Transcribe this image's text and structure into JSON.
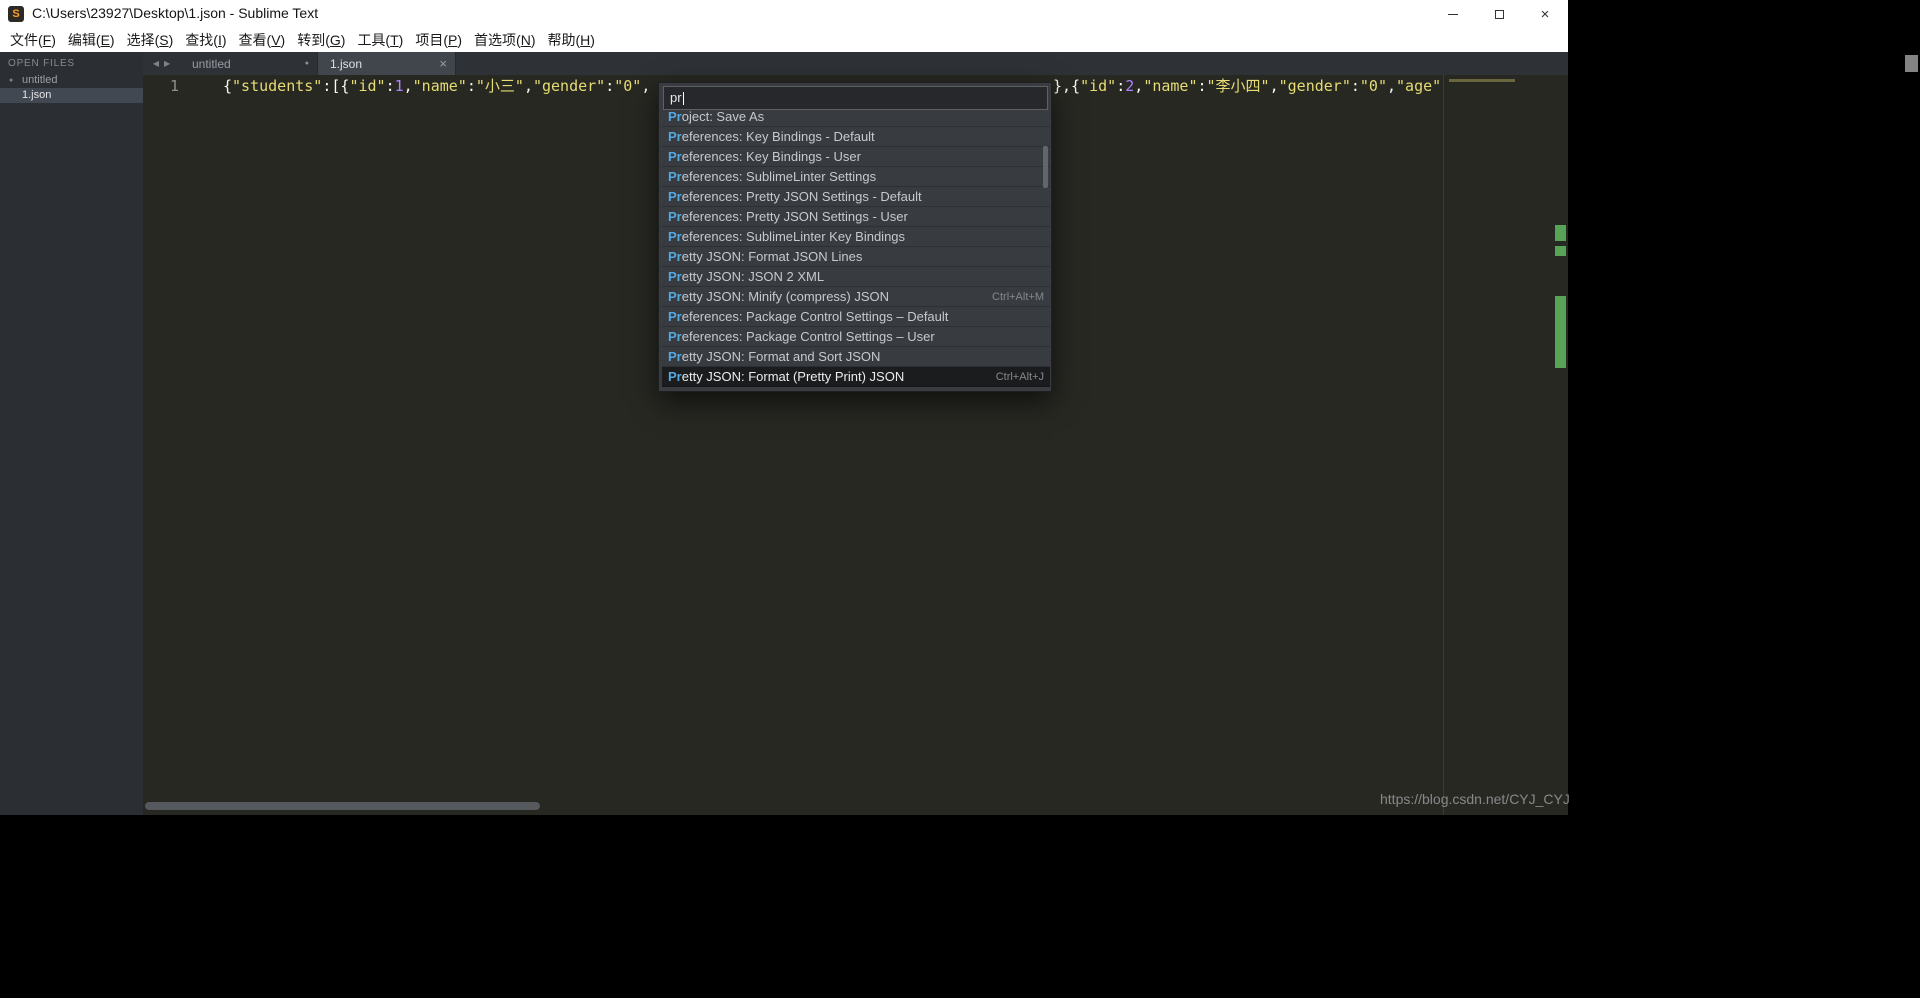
{
  "window": {
    "title": "C:\\Users\\23927\\Desktop\\1.json - Sublime Text"
  },
  "menu": {
    "items": [
      {
        "id": "file",
        "pre": "文件(",
        "key": "F",
        "post": ")"
      },
      {
        "id": "edit",
        "pre": "编辑(",
        "key": "E",
        "post": ")"
      },
      {
        "id": "selection",
        "pre": "选择(",
        "key": "S",
        "post": ")"
      },
      {
        "id": "find",
        "pre": "查找(",
        "key": "I",
        "post": ")"
      },
      {
        "id": "view",
        "pre": "查看(",
        "key": "V",
        "post": ")"
      },
      {
        "id": "goto",
        "pre": "转到(",
        "key": "G",
        "post": ")"
      },
      {
        "id": "tools",
        "pre": "工具(",
        "key": "T",
        "post": ")"
      },
      {
        "id": "project",
        "pre": "项目(",
        "key": "P",
        "post": ")"
      },
      {
        "id": "preferences",
        "pre": "首选项(",
        "key": "N",
        "post": ")"
      },
      {
        "id": "help",
        "pre": "帮助(",
        "key": "H",
        "post": ")"
      }
    ]
  },
  "sidebar": {
    "header": "OPEN FILES",
    "files": [
      {
        "name": "untitled",
        "modified": true,
        "selected": false
      },
      {
        "name": "1.json",
        "modified": false,
        "selected": true
      }
    ]
  },
  "tabs": [
    {
      "label": "untitled",
      "modified": true,
      "active": false
    },
    {
      "label": "1.json",
      "modified": false,
      "active": true
    }
  ],
  "editor": {
    "line_number": "1",
    "code_left": [
      {
        "t": "p",
        "s": "{"
      },
      {
        "t": "s",
        "s": "\"students\""
      },
      {
        "t": "p",
        "s": ":[{"
      },
      {
        "t": "s",
        "s": "\"id\""
      },
      {
        "t": "p",
        "s": ":"
      },
      {
        "t": "n",
        "s": "1"
      },
      {
        "t": "p",
        "s": ","
      },
      {
        "t": "s",
        "s": "\"name\""
      },
      {
        "t": "p",
        "s": ":"
      },
      {
        "t": "s",
        "s": "\"小三\""
      },
      {
        "t": "p",
        "s": ","
      },
      {
        "t": "s",
        "s": "\"gender\""
      },
      {
        "t": "p",
        "s": ":"
      },
      {
        "t": "s",
        "s": "\"0\""
      },
      {
        "t": "p",
        "s": ","
      }
    ],
    "code_right": [
      {
        "t": "p",
        "s": "},{"
      },
      {
        "t": "s",
        "s": "\"id\""
      },
      {
        "t": "p",
        "s": ":"
      },
      {
        "t": "n",
        "s": "2"
      },
      {
        "t": "p",
        "s": ","
      },
      {
        "t": "s",
        "s": "\"name\""
      },
      {
        "t": "p",
        "s": ":"
      },
      {
        "t": "s",
        "s": "\"李小四\""
      },
      {
        "t": "p",
        "s": ","
      },
      {
        "t": "s",
        "s": "\"gender\""
      },
      {
        "t": "p",
        "s": ":"
      },
      {
        "t": "s",
        "s": "\"0\""
      },
      {
        "t": "p",
        "s": ","
      },
      {
        "t": "s",
        "s": "\"age\""
      }
    ]
  },
  "palette": {
    "query": "pr",
    "items": [
      {
        "text": "Project: Save As",
        "shortcut": "",
        "selected": false
      },
      {
        "text": "Preferences: Key Bindings - Default",
        "shortcut": "",
        "selected": false
      },
      {
        "text": "Preferences: Key Bindings - User",
        "shortcut": "",
        "selected": false
      },
      {
        "text": "Preferences: SublimeLinter Settings",
        "shortcut": "",
        "selected": false
      },
      {
        "text": "Preferences: Pretty JSON Settings - Default",
        "shortcut": "",
        "selected": false
      },
      {
        "text": "Preferences: Pretty JSON Settings - User",
        "shortcut": "",
        "selected": false
      },
      {
        "text": "Preferences: SublimeLinter Key Bindings",
        "shortcut": "",
        "selected": false
      },
      {
        "text": "Pretty JSON: Format JSON Lines",
        "shortcut": "",
        "selected": false
      },
      {
        "text": "Pretty JSON: JSON 2 XML",
        "shortcut": "",
        "selected": false
      },
      {
        "text": "Pretty JSON: Minify (compress) JSON",
        "shortcut": "Ctrl+Alt+M",
        "selected": false
      },
      {
        "text": "Preferences: Package Control Settings – Default",
        "shortcut": "",
        "selected": false
      },
      {
        "text": "Preferences: Package Control Settings – User",
        "shortcut": "",
        "selected": false
      },
      {
        "text": "Pretty JSON: Format and Sort JSON",
        "shortcut": "",
        "selected": false
      },
      {
        "text": "Pretty JSON: Format (Pretty Print) JSON",
        "shortcut": "Ctrl+Alt+J",
        "selected": true
      }
    ]
  },
  "watermark": "https://blog.csdn.net/CYJ_CYJ",
  "colors": {
    "match_highlight": "#55a8e0",
    "string": "#e6db74",
    "number": "#ae81ff",
    "plain": "#f8f8f2",
    "editor_bg": "#272822",
    "scroll_mark_green": "#57a357"
  }
}
